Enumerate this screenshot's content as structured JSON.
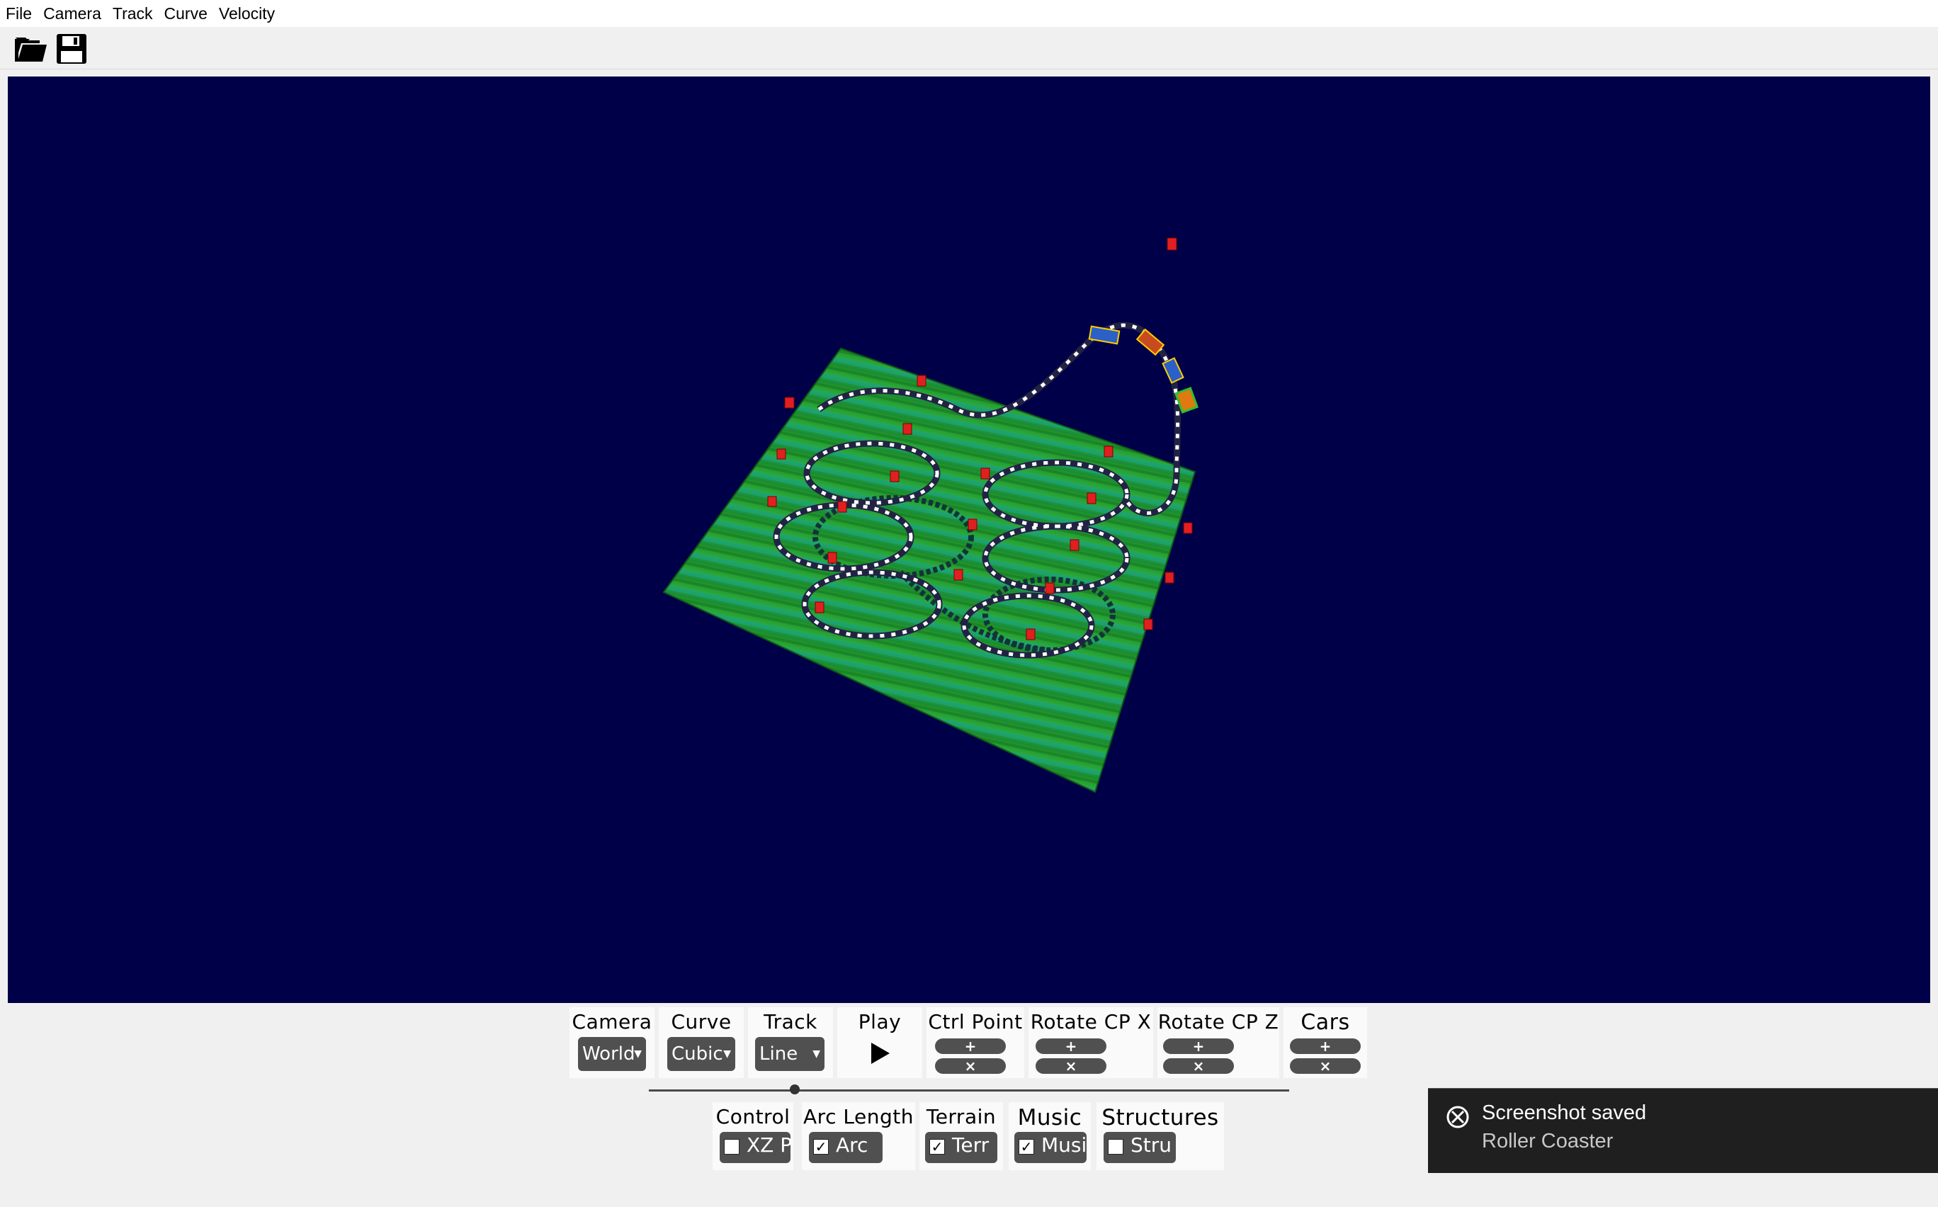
{
  "menu": [
    "File",
    "Camera",
    "Track",
    "Curve",
    "Velocity"
  ],
  "toolbar": {
    "open_icon": "folder-open-icon",
    "save_icon": "floppy-disk-icon"
  },
  "controls_row1": {
    "camera": {
      "title": "Camera",
      "value": "World"
    },
    "curve": {
      "title": "Curve",
      "value": "Cubic"
    },
    "track": {
      "title": "Track",
      "value": "Line"
    },
    "play": {
      "title": "Play"
    },
    "ctrl_point": {
      "title": "Ctrl Point",
      "add": "+",
      "remove": "×"
    },
    "rotate_x": {
      "title": "Rotate CP X",
      "add": "+",
      "remove": "×"
    },
    "rotate_z": {
      "title": "Rotate CP Z",
      "add": "+",
      "remove": "×"
    },
    "cars": {
      "title": "Cars",
      "add": "+",
      "remove": "×"
    }
  },
  "controls_row2": {
    "control": {
      "title": "Control",
      "label": "XZ P",
      "checked": false
    },
    "arc_length": {
      "title": "Arc Length",
      "label": "Arc",
      "checked": true
    },
    "terrain": {
      "title": "Terrain",
      "label": "Terr",
      "checked": true
    },
    "music": {
      "title": "Music",
      "label": "Music",
      "checked": true
    },
    "structures": {
      "title": "Structures",
      "label": "Stru",
      "checked": false
    }
  },
  "toast": {
    "title": "Screenshot saved",
    "subtitle": "Roller Coaster"
  },
  "colors": {
    "viewport_bg": "#000048",
    "terrain_green": "#2a9a2a",
    "terrain_teal": "#1fb0a0",
    "marker_red": "#e02020"
  }
}
